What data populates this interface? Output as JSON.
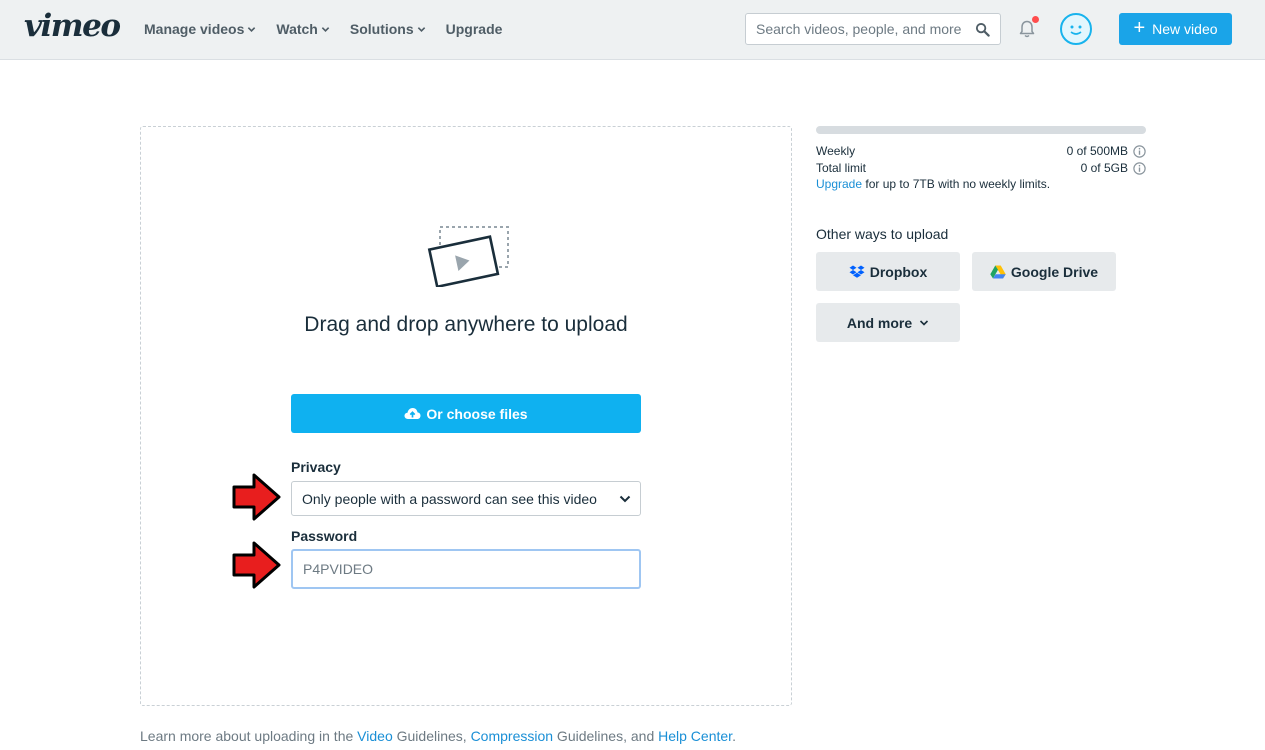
{
  "header": {
    "logo": "vimeo",
    "nav": [
      {
        "label": "Manage videos",
        "has_dropdown": true
      },
      {
        "label": "Watch",
        "has_dropdown": true
      },
      {
        "label": "Solutions",
        "has_dropdown": true
      },
      {
        "label": "Upgrade",
        "has_dropdown": false
      }
    ],
    "search_placeholder": "Search videos, people, and more",
    "new_video_label": "New video",
    "icons": {
      "search": "search-icon",
      "notifications": "bell-icon",
      "avatar": "avatar-icon",
      "plus": "plus-icon"
    }
  },
  "upload": {
    "drop_title": "Drag and drop anywhere to upload",
    "choose_files_label": "Or choose files",
    "privacy_label": "Privacy",
    "privacy_value": "Only people with a password can see this video",
    "password_label": "Password",
    "password_value": "P4PVIDEO"
  },
  "footer": {
    "prefix": "Learn more about uploading in the ",
    "link_video": "Video",
    "text_guidelines_1": " Guidelines, ",
    "link_compression": "Compression",
    "text_guidelines_2": " Guidelines, and ",
    "link_help": "Help Center",
    "suffix": "."
  },
  "sidebar": {
    "quota_used_fraction": 0,
    "weekly_label": "Weekly",
    "weekly_value": "0 of 500MB",
    "total_label": "Total limit",
    "total_value": "0 of 5GB",
    "upgrade_link": "Upgrade",
    "upgrade_text": " for up to 7TB with no weekly limits.",
    "other_ways_title": "Other ways to upload",
    "dropbox_label": "Dropbox",
    "gdrive_label": "Google Drive",
    "more_label": "And more"
  },
  "colors": {
    "brand_blue": "#1aa4e8",
    "choose_button": "#0fb1f0",
    "link": "#1a8fd6",
    "annotation_arrow": "#e81e1e"
  }
}
